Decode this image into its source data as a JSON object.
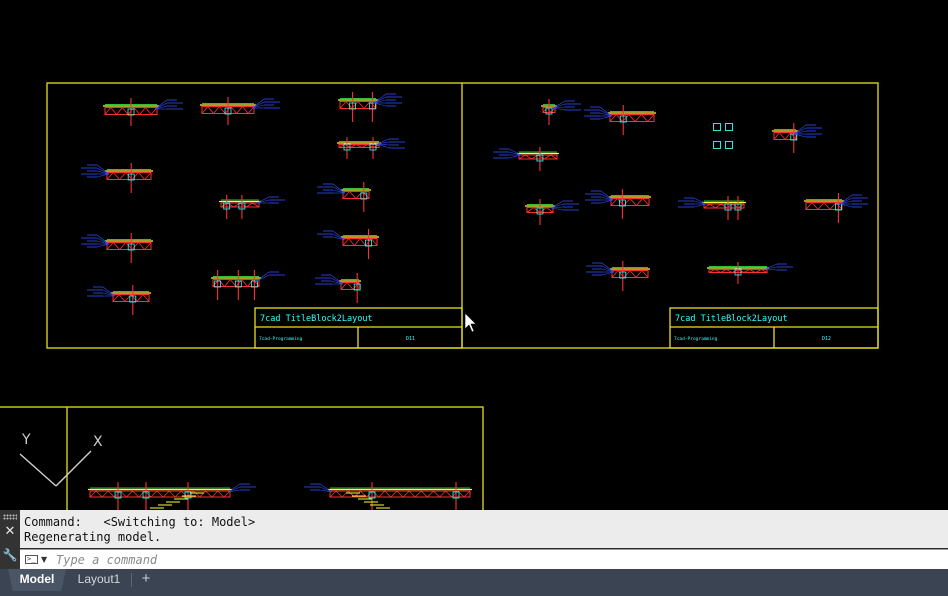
{
  "drawing": {
    "sheets": [
      {
        "title": "7cad TitleBlock2Layout",
        "author": "7cad-Programming",
        "sheet_no": "D11"
      },
      {
        "title": "7cad TitleBlock2Layout",
        "author": "7cad-Programming",
        "sheet_no": "D12"
      }
    ],
    "ucs": {
      "x_label": "X",
      "y_label": "Y"
    },
    "colors": {
      "background": "#000000",
      "frame": "#e8e020",
      "detail_red": "#ff3030",
      "detail_blue": "#3050ff",
      "detail_yellow": "#ffff40",
      "detail_green": "#40ff40",
      "detail_cyan": "#30ffff",
      "ucs": "#d0d0d0"
    }
  },
  "command_line": {
    "history": [
      "Command:   <Switching to: Model>",
      "Regenerating model."
    ],
    "input_placeholder": "Type a command",
    "prompt_glyph": ">_",
    "prompt_caret": "▼",
    "close_glyph": "✕",
    "customize_glyph": "🔧"
  },
  "tabs": {
    "model_label": "Model",
    "layout1_label": "Layout1",
    "add_label": "+"
  }
}
